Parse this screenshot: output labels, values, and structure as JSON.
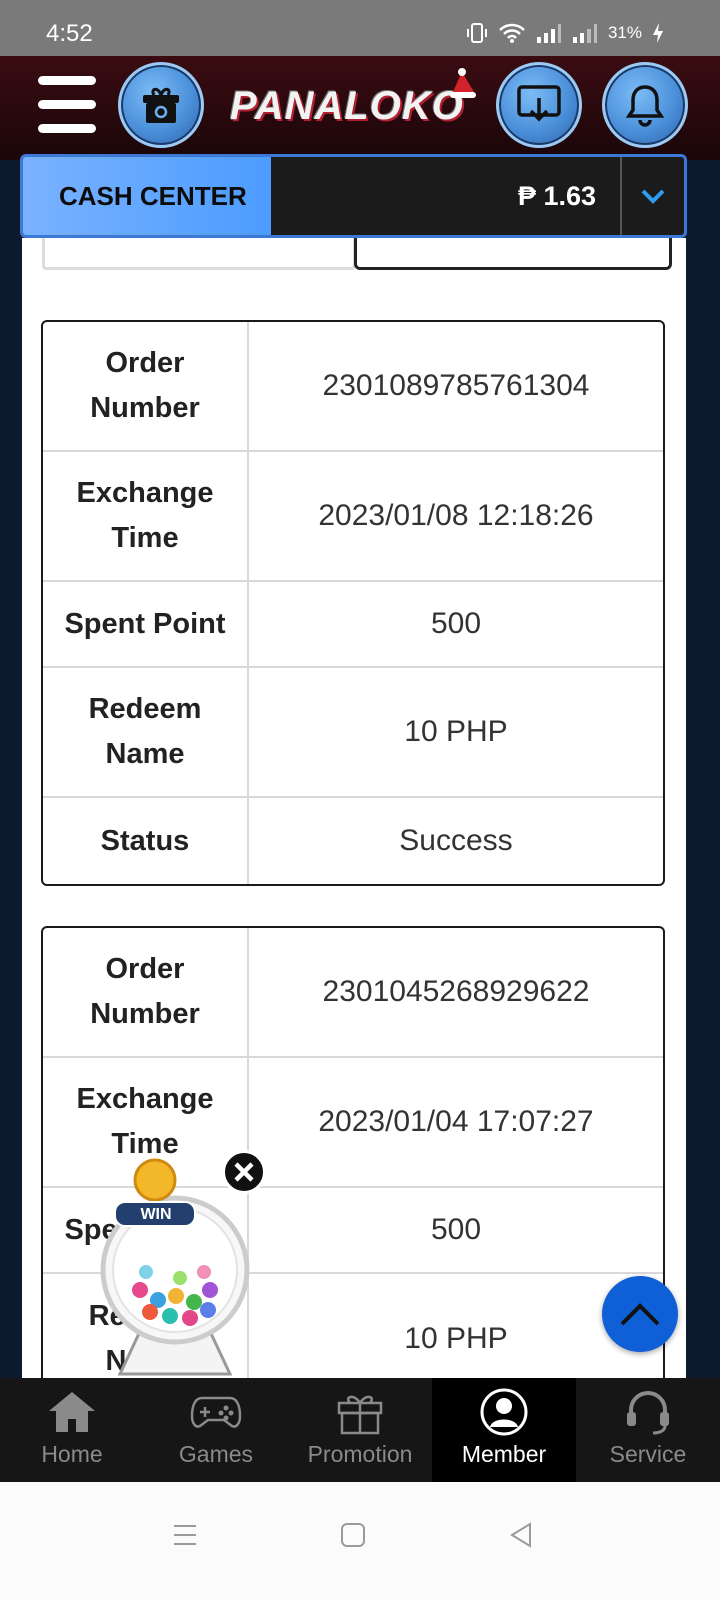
{
  "status_bar": {
    "time": "4:52",
    "battery": "31%"
  },
  "header": {
    "logo_text": "PANALOKO"
  },
  "cash_center": {
    "label": "CASH CENTER",
    "amount": "₱ 1.63"
  },
  "records": [
    {
      "order_number_label": "Order Number",
      "order_number": "2301089785761304",
      "exchange_time_label": "Exchange Time",
      "exchange_time": "2023/01/08 12:18:26",
      "spent_point_label": "Spent Point",
      "spent_point": "500",
      "redeem_name_label": "Redeem Name",
      "redeem_name": "10 PHP",
      "status_label": "Status",
      "status": "Success"
    },
    {
      "order_number_label": "Order Number",
      "order_number": "2301045268929622",
      "exchange_time_label": "Exchange Time",
      "exchange_time": "2023/01/04 17:07:27",
      "spent_point_label": "Spent Point",
      "spent_point": "500",
      "redeem_name_label": "Redeem Name",
      "redeem_name": "10 PHP"
    }
  ],
  "win_widget": {
    "badge": "WIN"
  },
  "bottom_nav": {
    "items": [
      {
        "label": "Home",
        "icon": "home-icon"
      },
      {
        "label": "Games",
        "icon": "gamepad-icon"
      },
      {
        "label": "Promotion",
        "icon": "gift-icon"
      },
      {
        "label": "Member",
        "icon": "member-icon",
        "active": true
      },
      {
        "label": "Service",
        "icon": "headset-icon"
      }
    ]
  },
  "colors": {
    "accent": "#4c9cff",
    "header_bg": "#2a0a0e",
    "scroll_button": "#0f5fd6"
  }
}
